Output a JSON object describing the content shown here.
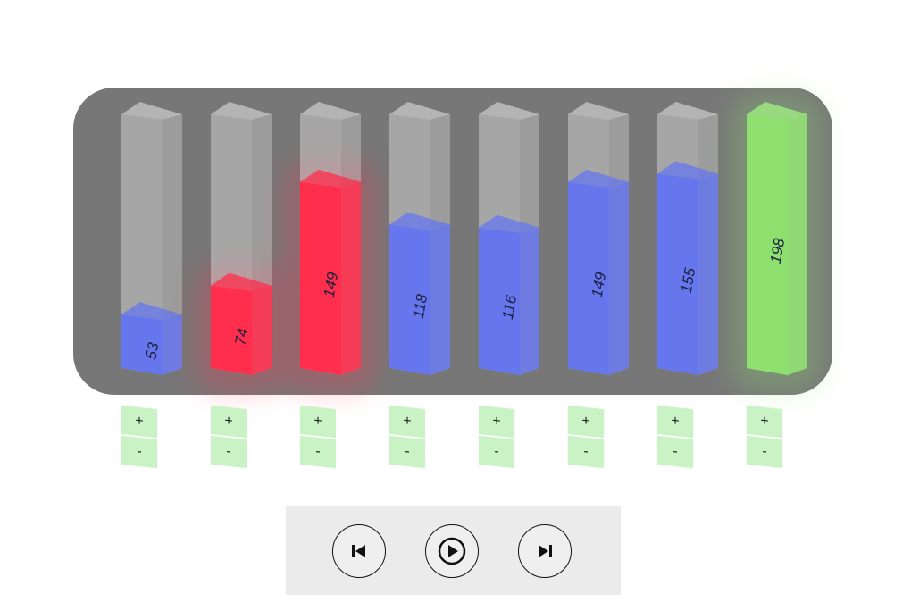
{
  "bars": [
    {
      "value": 53,
      "label": "53",
      "color": "#6677ee",
      "state": "default"
    },
    {
      "value": 74,
      "label": "74",
      "color": "#ff2e4c",
      "state": "compared"
    },
    {
      "value": 149,
      "label": "149",
      "color": "#ff2e4c",
      "state": "compared"
    },
    {
      "value": 118,
      "label": "118",
      "color": "#6677ee",
      "state": "default"
    },
    {
      "value": 116,
      "label": "116",
      "color": "#6677ee",
      "state": "default"
    },
    {
      "value": 149,
      "label": "149",
      "color": "#6677ee",
      "state": "default"
    },
    {
      "value": 155,
      "label": "155",
      "color": "#6677ee",
      "state": "default"
    },
    {
      "value": 198,
      "label": "198",
      "color": "#8ee06e",
      "state": "sorted"
    }
  ],
  "max_value": 198,
  "steppers": {
    "plus_label": "+",
    "minus_label": "-"
  },
  "controls": {
    "items": [
      {
        "name": "step-back-button",
        "icon": "skip-back-icon"
      },
      {
        "name": "play-button",
        "icon": "play-icon"
      },
      {
        "name": "step-forward-button",
        "icon": "skip-forward-icon"
      }
    ]
  },
  "colors": {
    "panel": "#777777",
    "default": "#6677ee",
    "compared": "#ff2e4c",
    "sorted": "#8ee06e",
    "stepper": "#c9f3c4"
  }
}
